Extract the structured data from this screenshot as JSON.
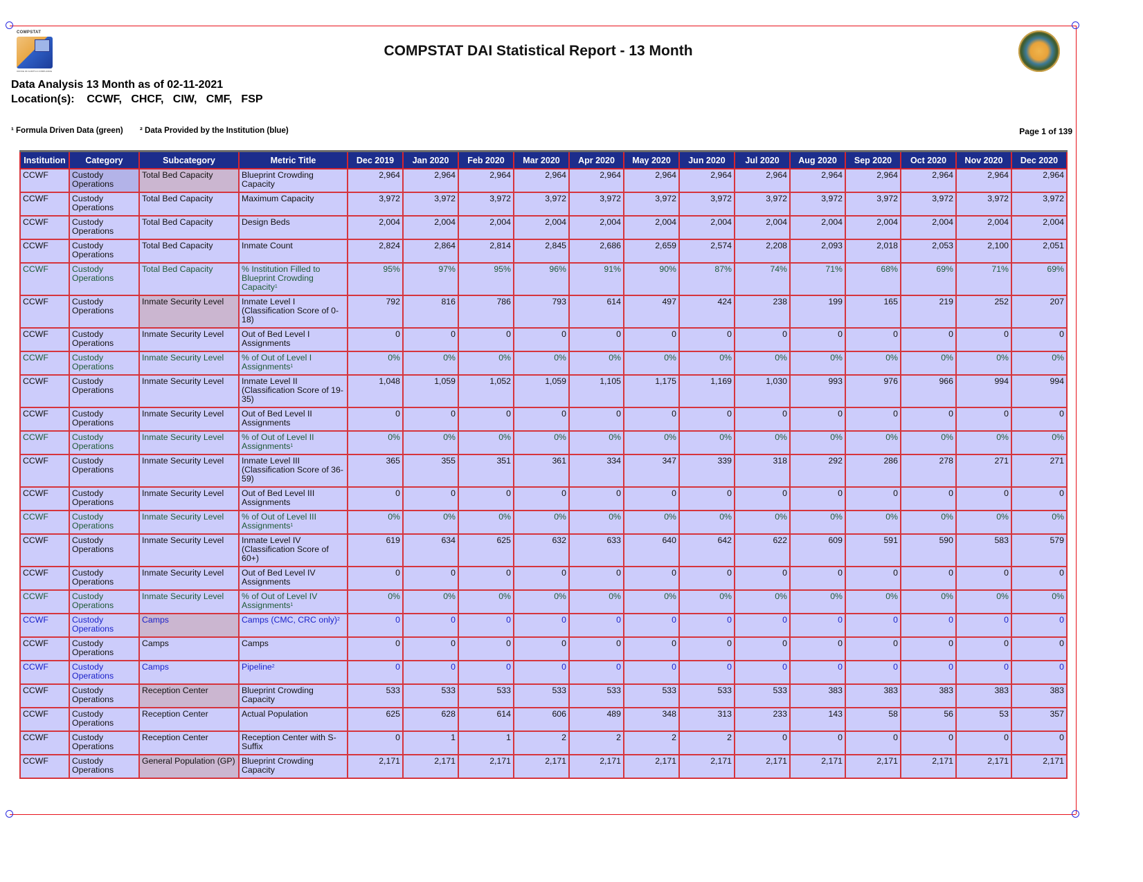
{
  "header": {
    "logo_caption": "COMPSTAT",
    "logo_footer": "OFFICE OF AUDITS & COMPLIANCE",
    "title": "COMPSTAT DAI Statistical Report - 13 Month",
    "analysis_line": "Data Analysis 13 Month as of 02-11-2021",
    "locations_line": "Location(s):    CCWF,   CHCF,   CIW,   CMF,   FSP",
    "note_green": "¹ Formula Driven Data (green)",
    "note_blue": "² Data Provided by the Institution (blue)",
    "page_indicator": "Page 1 of 139"
  },
  "colors": {
    "header_bg": "#1c2d8c",
    "cell_bg": "#ccccfb",
    "formula_green": "#1f5a36",
    "institution_blue": "#1b22c8",
    "grid_red": "#d6343c"
  },
  "table": {
    "columns": [
      "Institution",
      "Category",
      "Subcategory",
      "Metric Title",
      "Dec 2019",
      "Jan 2020",
      "Feb 2020",
      "Mar 2020",
      "Apr 2020",
      "May 2020",
      "Jun 2020",
      "Jul 2020",
      "Aug 2020",
      "Sep 2020",
      "Oct 2020",
      "Nov 2020",
      "Dec 2020"
    ],
    "rows": [
      {
        "type": "normal",
        "institution": "CCWF",
        "category": "Custody Operations",
        "subcategory": "Total Bed Capacity",
        "metric": "Blueprint Crowding Capacity",
        "note": "",
        "values": [
          "2,964",
          "2,964",
          "2,964",
          "2,964",
          "2,964",
          "2,964",
          "2,964",
          "2,964",
          "2,964",
          "2,964",
          "2,964",
          "2,964",
          "2,964"
        ]
      },
      {
        "type": "normal",
        "institution": "CCWF",
        "category": "Custody Operations",
        "subcategory": "Total Bed Capacity",
        "metric": "Maximum Capacity",
        "note": "",
        "values": [
          "3,972",
          "3,972",
          "3,972",
          "3,972",
          "3,972",
          "3,972",
          "3,972",
          "3,972",
          "3,972",
          "3,972",
          "3,972",
          "3,972",
          "3,972"
        ]
      },
      {
        "type": "normal",
        "institution": "CCWF",
        "category": "Custody Operations",
        "subcategory": "Total Bed Capacity",
        "metric": "Design Beds",
        "note": "",
        "values": [
          "2,004",
          "2,004",
          "2,004",
          "2,004",
          "2,004",
          "2,004",
          "2,004",
          "2,004",
          "2,004",
          "2,004",
          "2,004",
          "2,004",
          "2,004"
        ]
      },
      {
        "type": "normal",
        "institution": "CCWF",
        "category": "Custody Operations",
        "subcategory": "Total Bed Capacity",
        "metric": "Inmate Count",
        "note": "",
        "values": [
          "2,824",
          "2,864",
          "2,814",
          "2,845",
          "2,686",
          "2,659",
          "2,574",
          "2,208",
          "2,093",
          "2,018",
          "2,053",
          "2,100",
          "2,051"
        ]
      },
      {
        "type": "green",
        "institution": "CCWF",
        "category": "Custody Operations",
        "subcategory": "Total Bed Capacity",
        "metric": "% Institution Filled to Blueprint Crowding Capacity",
        "note": "1",
        "values": [
          "95%",
          "97%",
          "95%",
          "96%",
          "91%",
          "90%",
          "87%",
          "74%",
          "71%",
          "68%",
          "69%",
          "71%",
          "69%"
        ]
      },
      {
        "type": "normal",
        "institution": "CCWF",
        "category": "Custody Operations",
        "subcategory": "Inmate Security Level",
        "metric": "Inmate Level I (Classification Score of 0-18)",
        "note": "",
        "values": [
          "792",
          "816",
          "786",
          "793",
          "614",
          "497",
          "424",
          "238",
          "199",
          "165",
          "219",
          "252",
          "207"
        ]
      },
      {
        "type": "normal",
        "institution": "CCWF",
        "category": "Custody Operations",
        "subcategory": "Inmate Security Level",
        "metric": "Out of Bed Level I Assignments",
        "note": "",
        "values": [
          "0",
          "0",
          "0",
          "0",
          "0",
          "0",
          "0",
          "0",
          "0",
          "0",
          "0",
          "0",
          "0"
        ]
      },
      {
        "type": "green",
        "institution": "CCWF",
        "category": "Custody Operations",
        "subcategory": "Inmate Security Level",
        "metric": "% of Out of Level I Assignments",
        "note": "1",
        "values": [
          "0%",
          "0%",
          "0%",
          "0%",
          "0%",
          "0%",
          "0%",
          "0%",
          "0%",
          "0%",
          "0%",
          "0%",
          "0%"
        ]
      },
      {
        "type": "normal",
        "institution": "CCWF",
        "category": "Custody Operations",
        "subcategory": "Inmate Security Level",
        "metric": "Inmate Level II (Classification Score of 19-35)",
        "note": "",
        "values": [
          "1,048",
          "1,059",
          "1,052",
          "1,059",
          "1,105",
          "1,175",
          "1,169",
          "1,030",
          "993",
          "976",
          "966",
          "994",
          "994"
        ]
      },
      {
        "type": "normal",
        "institution": "CCWF",
        "category": "Custody Operations",
        "subcategory": "Inmate Security Level",
        "metric": "Out of Bed Level II Assignments",
        "note": "",
        "values": [
          "0",
          "0",
          "0",
          "0",
          "0",
          "0",
          "0",
          "0",
          "0",
          "0",
          "0",
          "0",
          "0"
        ]
      },
      {
        "type": "green",
        "institution": "CCWF",
        "category": "Custody Operations",
        "subcategory": "Inmate Security Level",
        "metric": "% of Out of Level II Assignments",
        "note": "1",
        "values": [
          "0%",
          "0%",
          "0%",
          "0%",
          "0%",
          "0%",
          "0%",
          "0%",
          "0%",
          "0%",
          "0%",
          "0%",
          "0%"
        ]
      },
      {
        "type": "normal",
        "institution": "CCWF",
        "category": "Custody Operations",
        "subcategory": "Inmate Security Level",
        "metric": "Inmate Level III (Classification Score of 36-59)",
        "note": "",
        "values": [
          "365",
          "355",
          "351",
          "361",
          "334",
          "347",
          "339",
          "318",
          "292",
          "286",
          "278",
          "271",
          "271"
        ]
      },
      {
        "type": "normal",
        "institution": "CCWF",
        "category": "Custody Operations",
        "subcategory": "Inmate Security Level",
        "metric": "Out of Bed Level III Assignments",
        "note": "",
        "values": [
          "0",
          "0",
          "0",
          "0",
          "0",
          "0",
          "0",
          "0",
          "0",
          "0",
          "0",
          "0",
          "0"
        ]
      },
      {
        "type": "green",
        "institution": "CCWF",
        "category": "Custody Operations",
        "subcategory": "Inmate Security Level",
        "metric": "% of Out of Level III Assignments",
        "note": "1",
        "values": [
          "0%",
          "0%",
          "0%",
          "0%",
          "0%",
          "0%",
          "0%",
          "0%",
          "0%",
          "0%",
          "0%",
          "0%",
          "0%"
        ]
      },
      {
        "type": "normal",
        "institution": "CCWF",
        "category": "Custody Operations",
        "subcategory": "Inmate Security Level",
        "metric": "Inmate Level IV (Classification Score of 60+)",
        "note": "",
        "values": [
          "619",
          "634",
          "625",
          "632",
          "633",
          "640",
          "642",
          "622",
          "609",
          "591",
          "590",
          "583",
          "579"
        ]
      },
      {
        "type": "normal",
        "institution": "CCWF",
        "category": "Custody Operations",
        "subcategory": "Inmate Security Level",
        "metric": "Out of Bed Level IV Assignments",
        "note": "",
        "values": [
          "0",
          "0",
          "0",
          "0",
          "0",
          "0",
          "0",
          "0",
          "0",
          "0",
          "0",
          "0",
          "0"
        ]
      },
      {
        "type": "green",
        "institution": "CCWF",
        "category": "Custody Operations",
        "subcategory": "Inmate Security Level",
        "metric": "% of Out of Level IV Assignments",
        "note": "1",
        "values": [
          "0%",
          "0%",
          "0%",
          "0%",
          "0%",
          "0%",
          "0%",
          "0%",
          "0%",
          "0%",
          "0%",
          "0%",
          "0%"
        ]
      },
      {
        "type": "blue",
        "institution": "CCWF",
        "category": "Custody Operations",
        "subcategory": "Camps",
        "metric": "Camps (CMC, CRC only)",
        "note": "2",
        "values": [
          "0",
          "0",
          "0",
          "0",
          "0",
          "0",
          "0",
          "0",
          "0",
          "0",
          "0",
          "0",
          "0"
        ]
      },
      {
        "type": "normal",
        "institution": "CCWF",
        "category": "Custody Operations",
        "subcategory": "Camps",
        "metric": "Camps",
        "note": "",
        "values": [
          "0",
          "0",
          "0",
          "0",
          "0",
          "0",
          "0",
          "0",
          "0",
          "0",
          "0",
          "0",
          "0"
        ]
      },
      {
        "type": "blue",
        "institution": "CCWF",
        "category": "Custody Operations",
        "subcategory": "Camps",
        "metric": "Pipeline",
        "note": "2",
        "values": [
          "0",
          "0",
          "0",
          "0",
          "0",
          "0",
          "0",
          "0",
          "0",
          "0",
          "0",
          "0",
          "0"
        ]
      },
      {
        "type": "normal",
        "institution": "CCWF",
        "category": "Custody Operations",
        "subcategory": "Reception Center",
        "metric": "Blueprint Crowding Capacity",
        "note": "",
        "values": [
          "533",
          "533",
          "533",
          "533",
          "533",
          "533",
          "533",
          "533",
          "383",
          "383",
          "383",
          "383",
          "383"
        ]
      },
      {
        "type": "normal",
        "institution": "CCWF",
        "category": "Custody Operations",
        "subcategory": "Reception Center",
        "metric": "Actual Population",
        "note": "",
        "values": [
          "625",
          "628",
          "614",
          "606",
          "489",
          "348",
          "313",
          "233",
          "143",
          "58",
          "56",
          "53",
          "357"
        ]
      },
      {
        "type": "normal",
        "institution": "CCWF",
        "category": "Custody Operations",
        "subcategory": "Reception Center",
        "metric": "Reception Center with S-Suffix",
        "note": "",
        "values": [
          "0",
          "1",
          "1",
          "2",
          "2",
          "2",
          "2",
          "0",
          "0",
          "0",
          "0",
          "0",
          "0"
        ]
      },
      {
        "type": "normal",
        "institution": "CCWF",
        "category": "Custody Operations",
        "subcategory": "General Population (GP)",
        "metric": "Blueprint Crowding Capacity",
        "note": "",
        "values": [
          "2,171",
          "2,171",
          "2,171",
          "2,171",
          "2,171",
          "2,171",
          "2,171",
          "2,171",
          "2,171",
          "2,171",
          "2,171",
          "2,171",
          "2,171"
        ]
      }
    ]
  }
}
